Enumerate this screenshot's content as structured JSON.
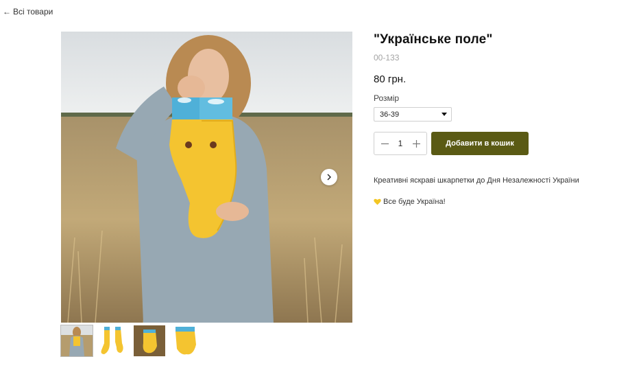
{
  "nav": {
    "back_label": "Всі товари"
  },
  "product": {
    "title": "\"Українське поле\"",
    "sku": "00-133",
    "price": "80 грн.",
    "size_label": "Розмір",
    "size_selected": "36-39",
    "quantity": "1",
    "add_to_cart_label": "Добавити в кошик",
    "description": "Креативні яскраві шкарпетки до Дня Незалежності України",
    "tagline": "Все буде Україна!"
  },
  "icons": {
    "back": "arrow-left-icon",
    "next": "chevron-right-icon",
    "minus": "minus-icon",
    "plus": "plus-icon",
    "heart": "yellow-heart-icon",
    "dropdown": "caret-down-icon"
  },
  "colors": {
    "add_button_bg": "#5a5a14",
    "sock_yellow": "#f4c430",
    "sock_blue": "#4fb0d8",
    "heart": "#f3c623"
  },
  "gallery": {
    "thumbnail_count": 4,
    "active_thumbnail": 1
  }
}
